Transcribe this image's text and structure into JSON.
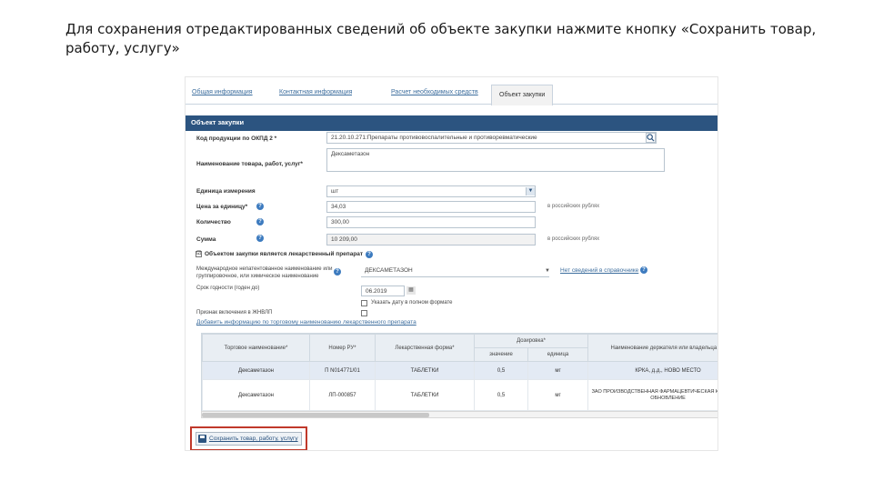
{
  "instruction": "Для сохранения отредактированных сведений об объекте закупки нажмите кнопку «Сохранить товар, работу, услугу»",
  "tabs": [
    "Общая информация",
    "Контактная информация",
    "Расчет необходимых средств",
    "Объект закупки"
  ],
  "section": {
    "title": "Объект закупки"
  },
  "form": {
    "okpd_label": "Код продукции по ОКПД 2 *",
    "okpd_value": "21.20.10.271:Препараты противовоспалительные и противоревматические",
    "name_label": "Наименование товара, работ, услуг*",
    "name_value": "Дексаметазон",
    "unit_label": "Единица измерения",
    "unit_value": "шт",
    "price_label": "Цена за единицу*",
    "price_value": "34,03",
    "price_note": "в российских рублях",
    "qty_label": "Количество",
    "qty_value": "300,00",
    "sum_label": "Сумма",
    "sum_value": "10 209,00",
    "sum_note": "в российских рублях",
    "drug_checkbox": "☑",
    "drug_label": "Объектом закупки является лекарственный препарат",
    "mnn_label": "Международное непатентованное наименование или группировочное, или химическое наименование",
    "mnn_value": "ДЕКСАМЕТАЗОН",
    "mnn_link": "Нет сведений в справочнике",
    "expiry_label": "Срок годности (годен до)",
    "expiry_value": "06.2019",
    "calendar_icon": "▦",
    "expiry_option": "Указать дату в полном формате",
    "vital_label": "Признак включения в ЖНВЛП",
    "add_link": "Добавить информацию по торговому наименованию лекарственного препарата"
  },
  "table": {
    "headers": {
      "trade_name": "Торговое наименование*",
      "reg_no": "Номер РУ*",
      "form": "Лекарственная форма*",
      "dosage": "Дозировка*",
      "dosage_value": "значение",
      "dosage_unit": "единица",
      "manufacturer": "Наименование держателя или владельца РУ"
    },
    "rows": [
      {
        "trade_name": "Дексаметазон",
        "reg_no": "П N014771/01",
        "form": "ТАБЛЕТКИ",
        "dose_value": "0,5",
        "dose_unit": "мг",
        "manufacturer": "КРКА, д.д., НОВО МЕСТО"
      },
      {
        "trade_name": "Дексаметазон",
        "reg_no": "ЛП-000857",
        "form": "ТАБЛЕТКИ",
        "dose_value": "0,5",
        "dose_unit": "мг",
        "manufacturer": "ЗАО ПРОИЗВОДСТВЕННАЯ ФАРМАЦЕВТИЧЕСКАЯ КОМПАНИЯ ОБНОВЛЕНИЕ"
      }
    ]
  },
  "save_button": "Сохранить товар, работу, услугу"
}
